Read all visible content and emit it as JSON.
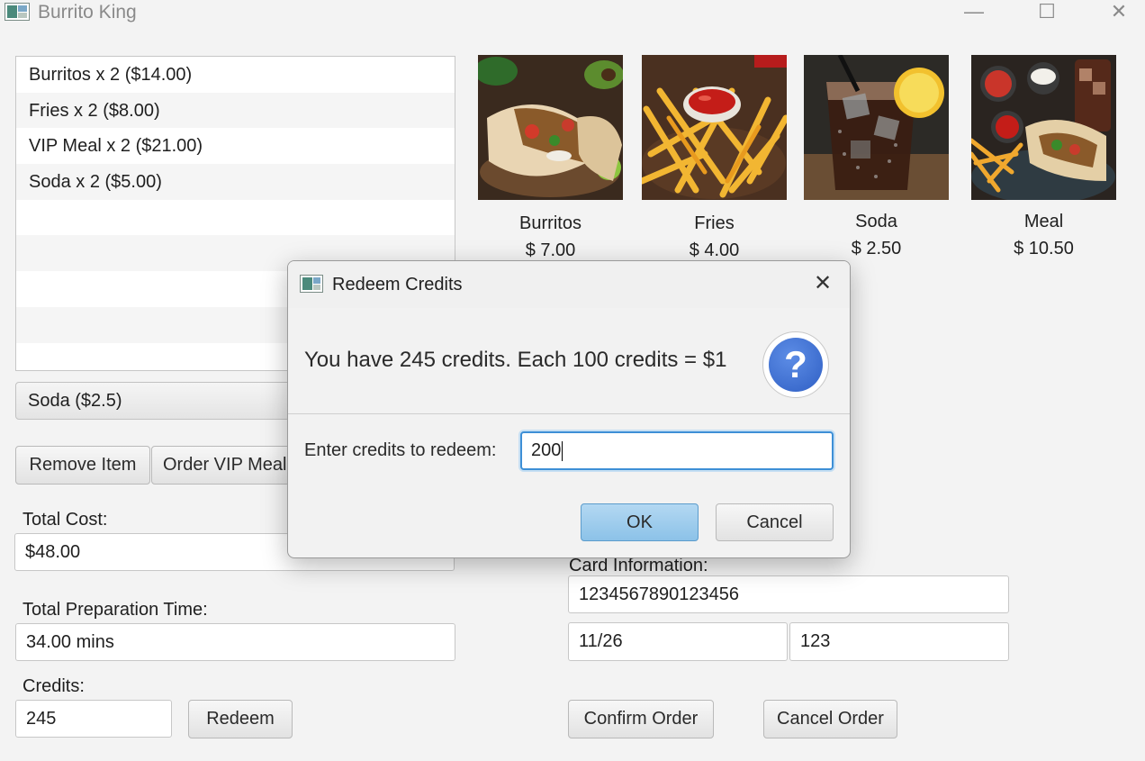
{
  "window": {
    "title": "Burrito King",
    "controls": {
      "minimize": "—",
      "maximize": "☐",
      "close": "✕"
    }
  },
  "order_list": {
    "items": [
      {
        "label": "Burritos x 2 ($14.00)"
      },
      {
        "label": "Fries x 2 ($8.00)"
      },
      {
        "label": "VIP Meal  x 2 ($21.00)"
      },
      {
        "label": "Soda x 2 ($5.00)"
      },
      {
        "label": ""
      },
      {
        "label": ""
      },
      {
        "label": ""
      },
      {
        "label": ""
      },
      {
        "label": ""
      }
    ]
  },
  "item_combo": {
    "selected": "Soda ($2.5)"
  },
  "buttons": {
    "remove_item": "Remove Item",
    "order_vip_meal": "Order VIP Meal",
    "redeem": "Redeem",
    "confirm_order": "Confirm Order",
    "cancel_order": "Cancel Order"
  },
  "totals": {
    "total_cost_label": "Total Cost:",
    "total_cost_value": "$48.00",
    "prep_time_label": "Total Preparation Time:",
    "prep_time_value": "34.00 mins",
    "credits_label": "Credits:",
    "credits_value": "245"
  },
  "card": {
    "label": "Card Information:",
    "number": "1234567890123456",
    "expiry": "11/26",
    "cvv": "123"
  },
  "menu": [
    {
      "name": "Burritos",
      "price": "$ 7.00"
    },
    {
      "name": "Fries",
      "price": "$ 4.00"
    },
    {
      "name": "Soda",
      "price": "$ 2.50"
    },
    {
      "name": "Meal",
      "price": "$ 10.50"
    }
  ],
  "dialog": {
    "title": "Redeem Credits",
    "message": "You have 245 credits. Each 100 credits = $1",
    "prompt": "Enter credits to redeem:",
    "input_value": "200",
    "ok": "OK",
    "cancel": "Cancel",
    "icon": "question-icon"
  }
}
